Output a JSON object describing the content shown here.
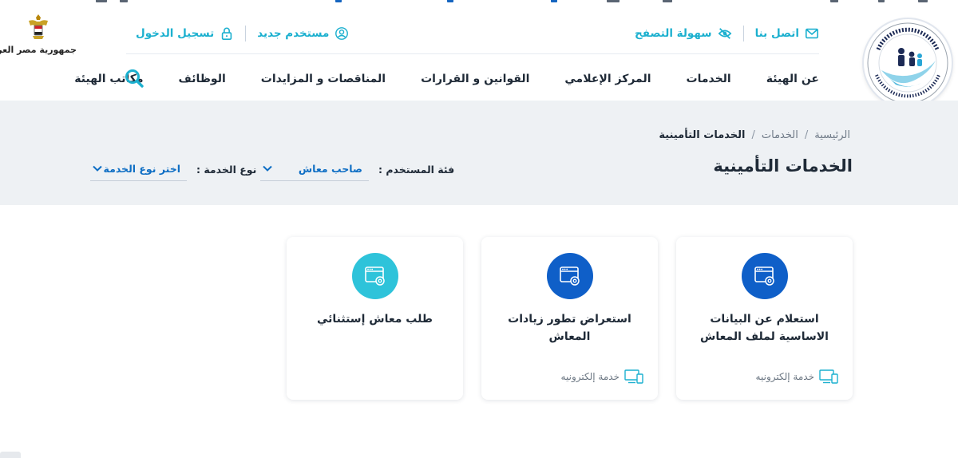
{
  "colors": {
    "accent": "#1cb0cf",
    "primary_blue": "#0e6ec4",
    "band_background": "#eef1f4",
    "icon_dark": "#0f5fc8",
    "icon_light": "#2ec3da"
  },
  "header": {
    "country_caption": "جمهورية مصر العربية",
    "utility_right": [
      {
        "label": "اتصل بنا",
        "icon": "mail-icon"
      },
      {
        "label": "سهولة التصفح",
        "icon": "eye-slash-icon"
      }
    ],
    "utility_left": [
      {
        "label": "مستخدم جديد",
        "icon": "user-icon"
      },
      {
        "label": "تسجيل الدخول",
        "icon": "lock-icon"
      }
    ],
    "nav": [
      "عن الهيئة",
      "الخدمات",
      "المركز الإعلامي",
      "القوانين و القرارات",
      "المناقصات و المزايدات",
      "الوظائف",
      "مكاتب الهيئة"
    ],
    "search_icon": "search-icon"
  },
  "band": {
    "breadcrumb": [
      "الرئيسية",
      "الخدمات",
      "الخدمات التأمينية"
    ],
    "title": "الخدمات التأمينية",
    "filters": {
      "user_label": "فئة المستخدم :",
      "user_value": "صاحب معاش",
      "type_label": "نوع الخدمة :",
      "type_value": "اختر نوع الخدمة"
    }
  },
  "cards": [
    {
      "title": "استعلام عن البيانات الاساسية لملف المعاش",
      "type_label": "خدمة إلكترونيه",
      "icon": "browser-gear-icon",
      "icon_color": "#0f5fc8"
    },
    {
      "title": "استعراض تطور زيادات المعاش",
      "type_label": "خدمة إلكترونيه",
      "icon": "browser-gear-icon",
      "icon_color": "#0f5fc8"
    },
    {
      "title": "طلب معاش إستثنائي",
      "type_label": "",
      "icon": "browser-gear-icon",
      "icon_color": "#2ec3da"
    }
  ]
}
